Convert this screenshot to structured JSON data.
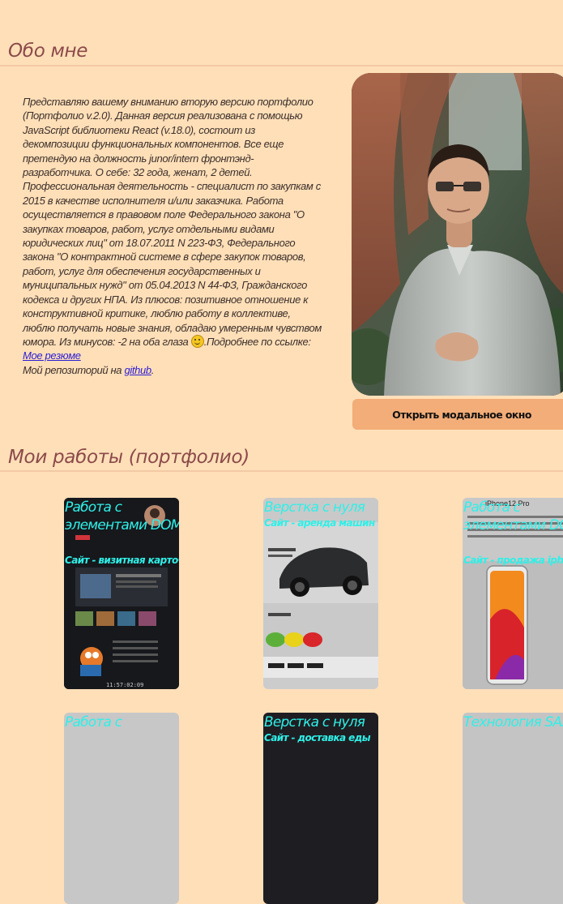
{
  "about": {
    "title": "Обо мне",
    "bio": "Представляю вашему вниманию вторую версию портфолио (Портфолио v.2.0). Данная версия реализована с помощью JavaScript библиотеки React (v.18.0), состоит из декомпозиции функциональных компонентов. Все еще претендую на должность junor/intern фронтэнд-разработчика. О себе: 32 года, женат, 2 детей. Профессиональная деятельность - специалист по закупкам с 2015 в качестве исполнителя и/или заказчика. Работа осуществляется в правовом поле Федерального закона \"О закупках товаров, работ, услуг отдельными видами юридических лиц\" от 18.07.2011 N 223-ФЗ, Федерального закона \"О контрактной системе в сфере закупок товаров, работ, услуг для обеспечения государственных и муниципальных нужд\" от 05.04.2013 N 44-ФЗ, Гражданского кодекса и других НПА. Из плюсов: позитивное отношение к конструктивной критике, люблю работу в коллективе, люблю получать новые знания, обладаю умеренным чувством юмора. Из минусов: -2 на оба глаза",
    "resume_prefix": ".Подробнее по ссылке: ",
    "resume_link": "Мое резюме",
    "repo_prefix": "Мой репозиторий на ",
    "repo_link": "github",
    "repo_suffix": ".",
    "modal_button": "Открыть модальное окно"
  },
  "works": {
    "title": "Мои работы (портфолио)",
    "cards": [
      {
        "title": "Работа с элементами DOM",
        "subtitle": "Сайт - визитная карточка",
        "clock": "11:57:02:09"
      },
      {
        "title": "Верстка с нуля",
        "subtitle": "Сайт - аренда машин"
      },
      {
        "title": "Работа с элементами DOM",
        "subtitle": "Сайт - продажа iphone",
        "device": "iPhone12 Pro"
      },
      {
        "title": "Работа с",
        "subtitle": ""
      },
      {
        "title": "Верстка с нуля",
        "subtitle": "Сайт - доставка еды"
      },
      {
        "title": "Технология SASS",
        "subtitle": ""
      }
    ]
  }
}
